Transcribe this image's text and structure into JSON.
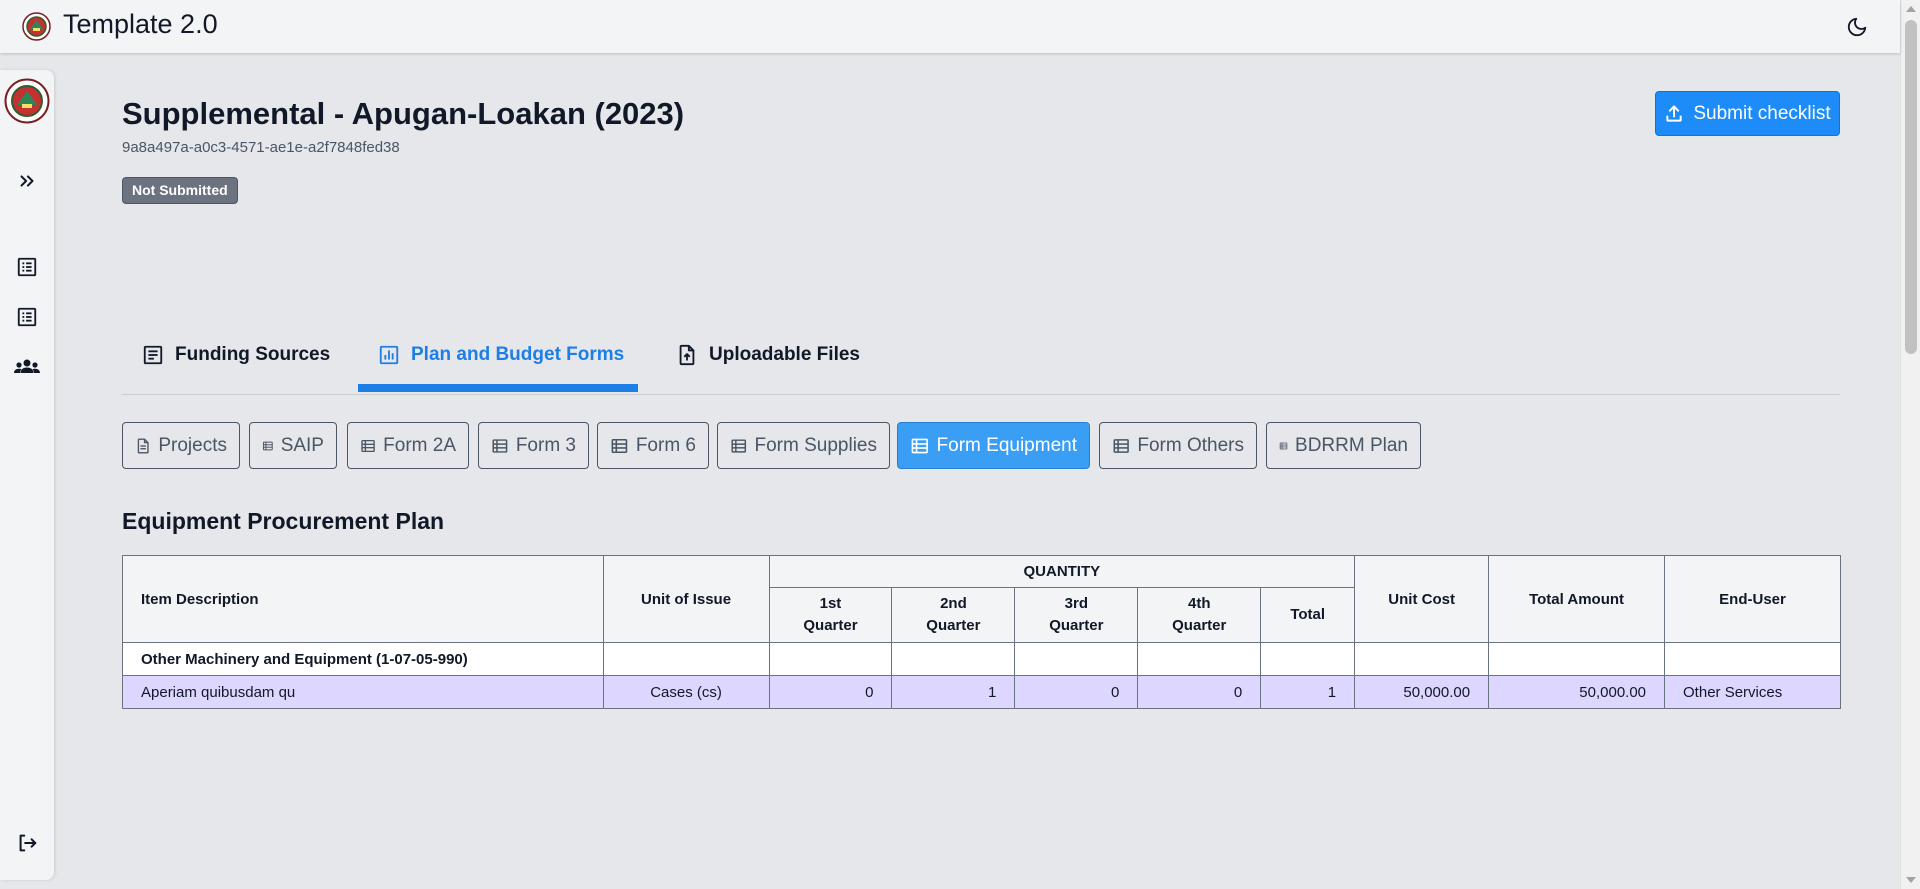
{
  "app": {
    "title": "Template 2.0",
    "logo_icon": "city-seal-logo",
    "theme_toggle_icon": "moon-icon"
  },
  "sidebar": {
    "logo_icon": "city-seal-logo",
    "items": [
      {
        "name": "expand",
        "icon": "chevrons-right-icon"
      },
      {
        "name": "list-1",
        "icon": "list-icon"
      },
      {
        "name": "list-2",
        "icon": "list-icon"
      },
      {
        "name": "users",
        "icon": "users-group-icon"
      },
      {
        "name": "logout",
        "icon": "logout-icon"
      }
    ]
  },
  "page": {
    "title": "Supplemental - Apugan-Loakan (2023)",
    "id": "9a8a497a-a0c3-4571-ae1e-a2f7848fed38",
    "status": "Not Submitted",
    "submit_label": "Submit checklist"
  },
  "tabs": [
    {
      "label": "Funding Sources",
      "icon": "document-text-icon",
      "active": false
    },
    {
      "label": "Plan and Budget Forms",
      "icon": "bar-chart-icon",
      "active": true
    },
    {
      "label": "Uploadable Files",
      "icon": "file-upload-icon",
      "active": false
    }
  ],
  "subtabs": [
    {
      "label": "Projects",
      "icon": "document-icon",
      "active": false
    },
    {
      "label": "SAIP",
      "icon": "table-list-icon",
      "active": false
    },
    {
      "label": "Form 2A",
      "icon": "table-list-icon",
      "active": false
    },
    {
      "label": "Form 3",
      "icon": "table-list-icon",
      "active": false
    },
    {
      "label": "Form 6",
      "icon": "table-list-icon",
      "active": false
    },
    {
      "label": "Form Supplies",
      "icon": "table-list-icon",
      "active": false
    },
    {
      "label": "Form Equipment",
      "icon": "table-list-icon",
      "active": true
    },
    {
      "label": "Form Others",
      "icon": "table-list-icon",
      "active": false
    },
    {
      "label": "BDRRM Plan",
      "icon": "table-list-icon",
      "active": false
    }
  ],
  "section": {
    "title": "Equipment Procurement Plan"
  },
  "table": {
    "headers": {
      "item_description": "Item Description",
      "unit_of_issue": "Unit of Issue",
      "quantity": "QUANTITY",
      "q1_line1": "1st",
      "q1_line2": "Quarter",
      "q2_line1": "2nd",
      "q2_line2": "Quarter",
      "q3_line1": "3rd",
      "q3_line2": "Quarter",
      "q4_line1": "4th",
      "q4_line2": "Quarter",
      "total": "Total",
      "unit_cost": "Unit Cost",
      "total_amount": "Total Amount",
      "end_user": "End-User"
    },
    "category": "Other Machinery and Equipment (1-07-05-990)",
    "rows": [
      {
        "item_description": "Aperiam quibusdam qu",
        "unit_of_issue": "Cases (cs)",
        "q1": "0",
        "q2": "1",
        "q3": "0",
        "q4": "0",
        "total": "1",
        "unit_cost": "50,000.00",
        "total_amount": "50,000.00",
        "end_user": "Other Services"
      }
    ]
  },
  "colors": {
    "accent": "#1d7ee6",
    "submit": "#1d8cf8",
    "badge": "#6b7280",
    "row_highlight": "#ddd6fe"
  }
}
